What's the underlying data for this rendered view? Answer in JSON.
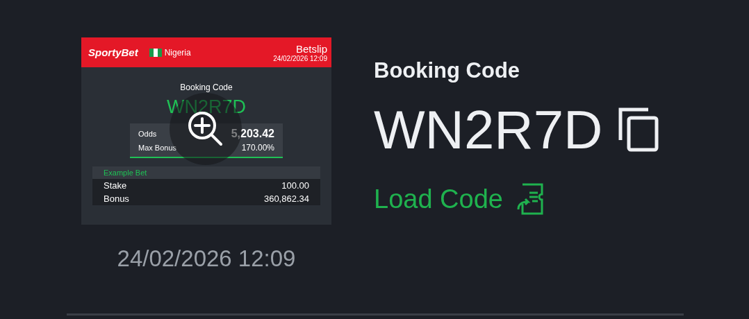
{
  "preview": {
    "brand": "SportyBet",
    "country": "Nigeria",
    "header_title": "Betslip",
    "header_date": "24/02/2026 12:09",
    "booking_label": "Booking Code",
    "code": "WN2R7D",
    "summary": [
      {
        "label": "Odds",
        "value": "5,203.42",
        "kind": "strong"
      },
      {
        "label": "Max Bonus",
        "value": "170.00%",
        "kind": "plain"
      }
    ],
    "example_title": "Example Bet",
    "example_rows": [
      {
        "label": "Stake",
        "value": "100.00"
      },
      {
        "label": "Bonus",
        "value": "360,862.34"
      }
    ]
  },
  "date": "24/02/2026 12:09",
  "booking_label": "Booking Code",
  "code": "WN2R7D",
  "load_label": "Load Code"
}
